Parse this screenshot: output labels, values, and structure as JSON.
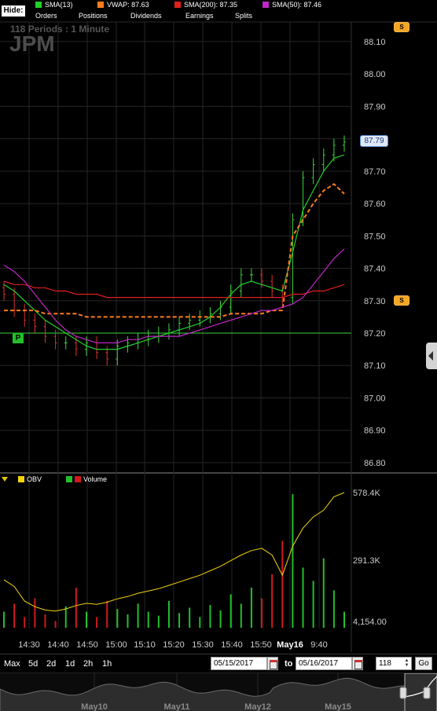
{
  "legend": {
    "hide_label": "Hide:",
    "indicators": [
      {
        "label": "SMA(13)",
        "color": "#22d02a"
      },
      {
        "label": "VWAP: 87.63",
        "color": "#ff7b1c"
      },
      {
        "label": "SMA(200): 87.35",
        "color": "#e0201c"
      },
      {
        "label": "SMA(50): 87.46",
        "color": "#c026c8"
      }
    ],
    "toggles": [
      "Orders",
      "Positions",
      "Dividends",
      "Earnings",
      "Splits"
    ]
  },
  "chart_header": {
    "periods": "118  Periods : 1 Minute",
    "ticker": "JPM"
  },
  "badges": {
    "s_label": "S",
    "p_label": "P",
    "last_price": "87.79"
  },
  "lower_legend": {
    "obv": {
      "label": "OBV",
      "color": "#f2d40c"
    },
    "volume": {
      "label": "Volume",
      "colors": [
        "#22c02a",
        "#d01a1a"
      ]
    }
  },
  "toolbar": {
    "ranges": [
      "Max",
      "5d",
      "2d",
      "1d",
      "2h",
      "1h"
    ],
    "from_date": "05/15/2017",
    "to_label": "to",
    "to_date": "05/16/2017",
    "periods_value": "118",
    "go_label": "Go"
  },
  "navigator": {
    "labels": [
      "May10",
      "May11",
      "May12",
      "May15"
    ]
  },
  "chart_data": [
    {
      "type": "candlestick",
      "title": "",
      "ylim": [
        86.75,
        88.15
      ],
      "y_ticks": [
        "88.10",
        "88.00",
        "87.90",
        "87.80",
        "87.70",
        "87.60",
        "87.50",
        "87.40",
        "87.30",
        "87.20",
        "87.10",
        "87.00",
        "86.90",
        "86.80"
      ],
      "x_ticks": [
        "14:30",
        "14:40",
        "14:50",
        "15:00",
        "15:10",
        "15:20",
        "15:30",
        "15:40",
        "15:50",
        "May16",
        "9:40"
      ],
      "horizontal_line": 87.2,
      "last_price": 87.79,
      "series": [
        {
          "name": "SMA(13)",
          "color": "#22d02a",
          "values": [
            87.35,
            87.33,
            87.3,
            87.27,
            87.24,
            87.22,
            87.2,
            87.18,
            87.16,
            87.15,
            87.15,
            87.15,
            87.16,
            87.17,
            87.18,
            87.19,
            87.2,
            87.21,
            87.22,
            87.23,
            87.25,
            87.28,
            87.32,
            87.35,
            87.36,
            87.35,
            87.34,
            87.33,
            87.45,
            87.58,
            87.64,
            87.7,
            87.74,
            87.75
          ]
        },
        {
          "name": "VWAP",
          "color": "#ff7b1c",
          "values": [
            87.27,
            87.27,
            87.27,
            87.27,
            87.26,
            87.26,
            87.26,
            87.26,
            87.25,
            87.25,
            87.25,
            87.25,
            87.25,
            87.25,
            87.25,
            87.25,
            87.25,
            87.25,
            87.25,
            87.25,
            87.25,
            87.25,
            87.26,
            87.26,
            87.26,
            87.26,
            87.27,
            87.27,
            87.5,
            87.55,
            87.6,
            87.64,
            87.66,
            87.63
          ]
        },
        {
          "name": "SMA(200)",
          "color": "#e0201c",
          "values": [
            87.36,
            87.35,
            87.35,
            87.34,
            87.34,
            87.33,
            87.33,
            87.32,
            87.32,
            87.32,
            87.31,
            87.31,
            87.31,
            87.31,
            87.31,
            87.31,
            87.31,
            87.31,
            87.31,
            87.31,
            87.31,
            87.31,
            87.31,
            87.31,
            87.31,
            87.31,
            87.31,
            87.31,
            87.32,
            87.32,
            87.33,
            87.33,
            87.34,
            87.35
          ]
        },
        {
          "name": "SMA(50)",
          "color": "#c026c8",
          "values": [
            87.41,
            87.39,
            87.36,
            87.32,
            87.28,
            87.24,
            87.21,
            87.19,
            87.18,
            87.17,
            87.17,
            87.17,
            87.18,
            87.18,
            87.19,
            87.19,
            87.19,
            87.19,
            87.2,
            87.21,
            87.22,
            87.23,
            87.24,
            87.25,
            87.26,
            87.27,
            87.27,
            87.28,
            87.29,
            87.31,
            87.35,
            87.39,
            87.43,
            87.46
          ]
        }
      ],
      "candles": [
        87.32,
        87.27,
        87.24,
        87.22,
        87.19,
        87.17,
        87.17,
        87.15,
        87.17,
        87.14,
        87.12,
        87.16,
        87.17,
        87.18,
        87.19,
        87.2,
        87.21,
        87.23,
        87.24,
        87.25,
        87.26,
        87.28,
        87.33,
        87.38,
        87.38,
        87.36,
        87.33,
        87.31,
        87.55,
        87.68,
        87.72,
        87.75,
        87.78,
        87.79
      ]
    },
    {
      "type": "bar",
      "title": "",
      "ylim": [
        0,
        600000
      ],
      "y_ticks": [
        "578.4K",
        "291.3K",
        "4,154.00"
      ],
      "series": [
        {
          "name": "OBV",
          "color": "#f2d40c",
          "values": [
            190000,
            160000,
            95000,
            70000,
            55000,
            50000,
            60000,
            75000,
            85000,
            80000,
            90000,
            105000,
            115000,
            130000,
            140000,
            150000,
            165000,
            180000,
            195000,
            210000,
            230000,
            250000,
            275000,
            300000,
            320000,
            330000,
            300000,
            210000,
            340000,
            420000,
            470000,
            500000,
            560000,
            578400
          ]
        },
        {
          "name": "Volume",
          "colors": [
            "#22c02a",
            "#d01a1a"
          ]
        }
      ]
    }
  ]
}
